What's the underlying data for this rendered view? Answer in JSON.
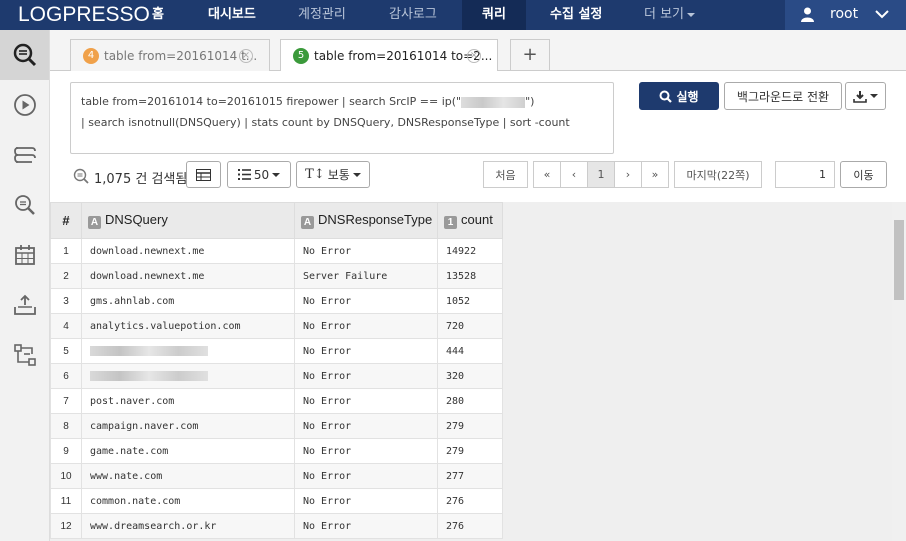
{
  "app": {
    "logo": "LOGPRESSO"
  },
  "nav": {
    "items": [
      {
        "label": "홈"
      },
      {
        "label": "대시보드"
      },
      {
        "label": "계정관리"
      },
      {
        "label": "감사로그"
      },
      {
        "label": "쿼리"
      },
      {
        "label": "수집 설정"
      },
      {
        "label": "더 보기"
      }
    ],
    "user": "root"
  },
  "sidebar": {
    "icons": [
      "query-icon",
      "play-icon",
      "layers-icon",
      "search-detail-icon",
      "calendar-icon",
      "upload-icon",
      "flow-icon"
    ]
  },
  "tabs": [
    {
      "number": "4",
      "label": "table from=20161014 t..."
    },
    {
      "number": "5",
      "label": "table from=20161014 to=2..."
    }
  ],
  "query": {
    "line1_prefix": "table from=20161014 to=20161015 firepower | search SrcIP == ip(\"",
    "line1_suffix": "\")",
    "line2": "| search isnotnull(DNSQuery) | stats count by DNSQuery, DNSResponseType | sort -count"
  },
  "toolbar": {
    "run": "실행",
    "background": "백그라운드로 전환",
    "result_count": "1,075 건 검색됨",
    "page_size": "50",
    "font_size": "보통",
    "first": "처음",
    "prev_fast": "«",
    "prev": "‹",
    "current_page": "1",
    "next": "›",
    "next_fast": "»",
    "last": "마지막(22쪽)",
    "goto_value": "1",
    "goto": "이동"
  },
  "table": {
    "columns": [
      {
        "label": "#"
      },
      {
        "label": "DNSQuery",
        "type": "A"
      },
      {
        "label": "DNSResponseType",
        "type": "A"
      },
      {
        "label": "count",
        "type": "1"
      }
    ],
    "rows": [
      {
        "idx": "1",
        "query": "download.newnext.me",
        "response": "No Error",
        "count": "14922"
      },
      {
        "idx": "2",
        "query": "download.newnext.me",
        "response": "Server Failure",
        "count": "13528"
      },
      {
        "idx": "3",
        "query": "gms.ahnlab.com",
        "response": "No Error",
        "count": "1052"
      },
      {
        "idx": "4",
        "query": "analytics.valuepotion.com",
        "response": "No Error",
        "count": "720"
      },
      {
        "idx": "5",
        "query": "",
        "response": "No Error",
        "count": "444"
      },
      {
        "idx": "6",
        "query": "",
        "response": "No Error",
        "count": "320"
      },
      {
        "idx": "7",
        "query": "post.naver.com",
        "response": "No Error",
        "count": "280"
      },
      {
        "idx": "8",
        "query": "campaign.naver.com",
        "response": "No Error",
        "count": "279"
      },
      {
        "idx": "9",
        "query": "game.nate.com",
        "response": "No Error",
        "count": "279"
      },
      {
        "idx": "10",
        "query": "www.nate.com",
        "response": "No Error",
        "count": "277"
      },
      {
        "idx": "11",
        "query": "common.nate.com",
        "response": "No Error",
        "count": "276"
      },
      {
        "idx": "12",
        "query": "www.dreamsearch.or.kr",
        "response": "No Error",
        "count": "276"
      }
    ]
  },
  "colors": {
    "nav_bg": "#1e3a6e",
    "tab4_badge": "#f0a14a",
    "tab5_badge": "#3b9a3b"
  }
}
